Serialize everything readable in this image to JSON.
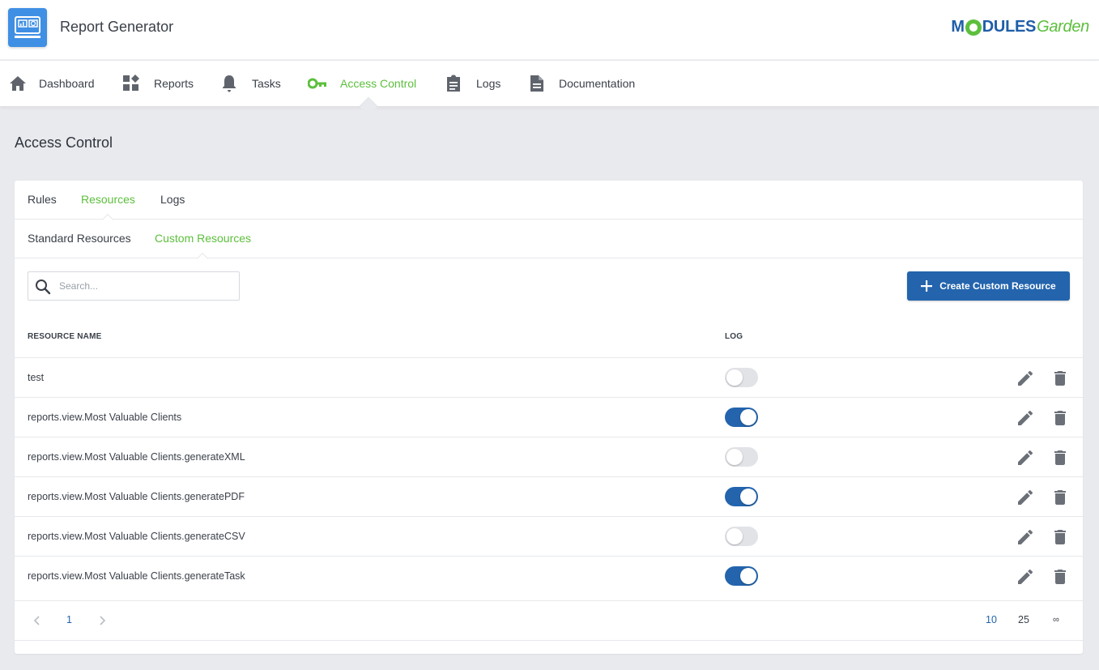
{
  "app": {
    "title": "Report Generator"
  },
  "brand": {
    "part1": "M",
    "part2": "DULES",
    "part3": "Garden"
  },
  "nav": {
    "items": [
      {
        "label": "Dashboard",
        "icon": "home-icon"
      },
      {
        "label": "Reports",
        "icon": "reports-icon"
      },
      {
        "label": "Tasks",
        "icon": "bell-icon"
      },
      {
        "label": "Access Control",
        "icon": "key-icon",
        "active": true
      },
      {
        "label": "Logs",
        "icon": "clipboard-icon"
      },
      {
        "label": "Documentation",
        "icon": "document-icon"
      }
    ]
  },
  "page": {
    "title": "Access Control"
  },
  "tabs": {
    "primary": [
      {
        "label": "Rules"
      },
      {
        "label": "Resources",
        "active": true
      },
      {
        "label": "Logs"
      }
    ],
    "secondary": [
      {
        "label": "Standard Resources"
      },
      {
        "label": "Custom Resources",
        "active": true
      }
    ]
  },
  "search": {
    "placeholder": "Search...",
    "value": ""
  },
  "toolbar": {
    "create_label": "Create Custom Resource"
  },
  "table": {
    "columns": [
      "RESOURCE NAME",
      "LOG"
    ],
    "rows": [
      {
        "name": "test",
        "log": false
      },
      {
        "name": "reports.view.Most Valuable Clients",
        "log": true
      },
      {
        "name": "reports.view.Most Valuable Clients.generateXML",
        "log": false
      },
      {
        "name": "reports.view.Most Valuable Clients.generatePDF",
        "log": true
      },
      {
        "name": "reports.view.Most Valuable Clients.generateCSV",
        "log": false
      },
      {
        "name": "reports.view.Most Valuable Clients.generateTask",
        "log": true
      }
    ]
  },
  "pagination": {
    "current_page": "1",
    "page_sizes": [
      "10",
      "25",
      "∞"
    ],
    "selected_size": "10"
  },
  "colors": {
    "accent_green": "#5cbf3c",
    "primary_blue": "#2364ad",
    "toggle_off": "#e1e3e7"
  }
}
